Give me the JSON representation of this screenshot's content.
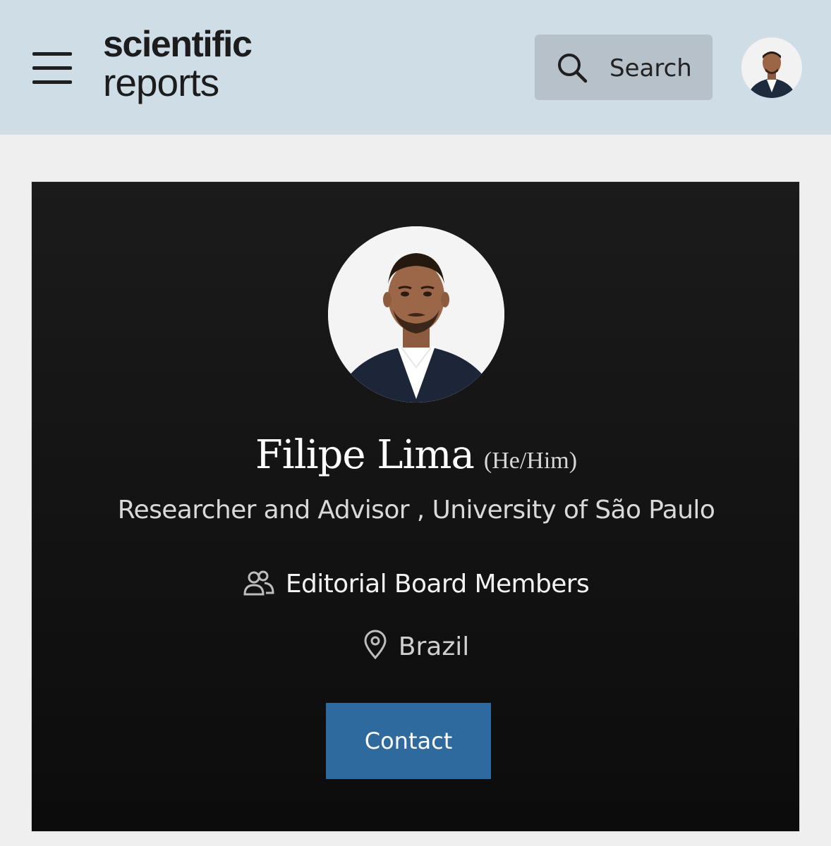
{
  "header": {
    "logo": {
      "line1": "scientific",
      "line2": "reports"
    },
    "menu_icon": "hamburger-menu-icon",
    "search": {
      "label": "Search",
      "icon": "search-icon"
    },
    "user_avatar": "user-avatar"
  },
  "profile": {
    "name": "Filipe Lima",
    "pronouns": "(He/Him)",
    "affiliation": "Researcher and Advisor , University of São Paulo",
    "role": "Editorial Board Members",
    "role_icon": "people-icon",
    "location": "Brazil",
    "location_icon": "map-pin-icon",
    "contact_label": "Contact"
  },
  "colors": {
    "header_bg": "#cfdde6",
    "card_bg": "#141414",
    "contact_button": "#2f6a9e",
    "search_button": "#b7c1ca"
  }
}
